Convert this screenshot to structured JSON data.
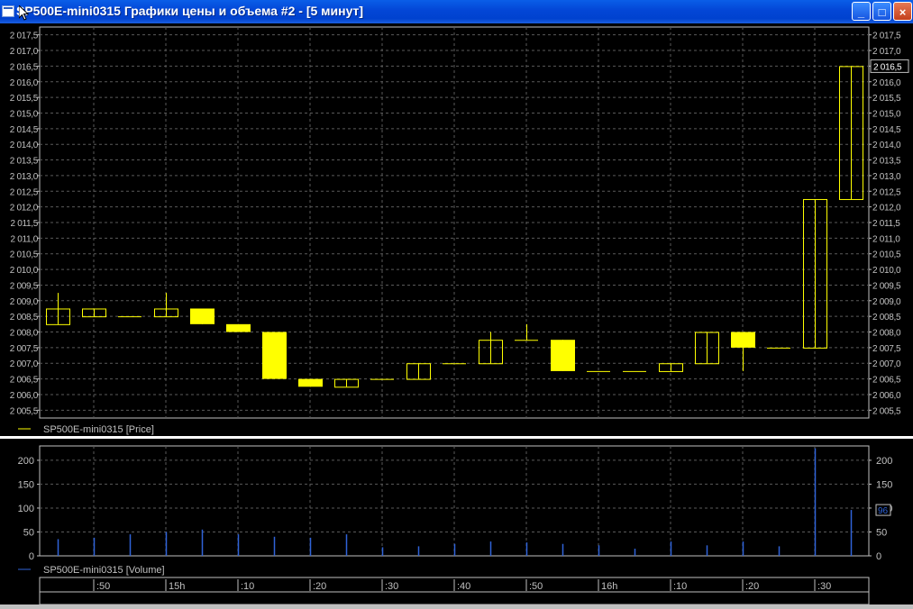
{
  "window": {
    "title": "SP500E-mini0315 Графики цены и объема #2 - [5 минут]",
    "buttons": {
      "minimize": "_",
      "maximize": "□",
      "close": "×"
    }
  },
  "colors": {
    "background": "#000000",
    "grid": "#5a5a5a",
    "axis": "#c0c0c0",
    "candle": "#ffff00",
    "volume": "#2f63d8",
    "titlebar": "#0346d6"
  },
  "chart_data": [
    {
      "type": "candlestick",
      "legend": "SP500E-mini0315 [Price]",
      "ylim": [
        2005.25,
        2017.75
      ],
      "yticks": [
        "2 005,5",
        "2 006,0",
        "2 006,5",
        "2 007,0",
        "2 007,5",
        "2 008,0",
        "2 008,5",
        "2 009,0",
        "2 009,5",
        "2 010,0",
        "2 010,5",
        "2 011,0",
        "2 011,5",
        "2 012,0",
        "2 012,5",
        "2 013,0",
        "2 013,5",
        "2 014,0",
        "2 014,5",
        "2 015,0",
        "2 015,5",
        "2 016,0",
        "2 016,5",
        "2 017,0",
        "2 017,5"
      ],
      "last_value_label": "2 016,5",
      "last_value": 2016.5,
      "candles": [
        {
          "o": 2008.25,
          "h": 2009.25,
          "l": 2008.25,
          "c": 2008.75
        },
        {
          "o": 2008.5,
          "h": 2008.75,
          "l": 2008.5,
          "c": 2008.75
        },
        {
          "o": 2008.5,
          "h": 2008.5,
          "l": 2008.5,
          "c": 2008.5
        },
        {
          "o": 2008.5,
          "h": 2009.25,
          "l": 2008.5,
          "c": 2008.75
        },
        {
          "o": 2008.75,
          "h": 2008.75,
          "l": 2008.25,
          "c": 2008.25
        },
        {
          "o": 2008.25,
          "h": 2008.25,
          "l": 2008.0,
          "c": 2008.0
        },
        {
          "o": 2008.0,
          "h": 2008.0,
          "l": 2006.5,
          "c": 2006.5
        },
        {
          "o": 2006.5,
          "h": 2006.5,
          "l": 2006.25,
          "c": 2006.25
        },
        {
          "o": 2006.25,
          "h": 2006.5,
          "l": 2006.25,
          "c": 2006.5
        },
        {
          "o": 2006.5,
          "h": 2006.5,
          "l": 2006.5,
          "c": 2006.5
        },
        {
          "o": 2006.5,
          "h": 2007.0,
          "l": 2006.5,
          "c": 2007.0
        },
        {
          "o": 2007.0,
          "h": 2007.0,
          "l": 2007.0,
          "c": 2007.0
        },
        {
          "o": 2007.0,
          "h": 2008.0,
          "l": 2007.0,
          "c": 2007.75
        },
        {
          "o": 2007.75,
          "h": 2008.25,
          "l": 2007.75,
          "c": 2007.75
        },
        {
          "o": 2007.75,
          "h": 2007.75,
          "l": 2006.75,
          "c": 2006.75
        },
        {
          "o": 2006.75,
          "h": 2006.75,
          "l": 2006.75,
          "c": 2006.75
        },
        {
          "o": 2006.75,
          "h": 2006.75,
          "l": 2006.75,
          "c": 2006.75
        },
        {
          "o": 2006.75,
          "h": 2007.0,
          "l": 2006.75,
          "c": 2007.0
        },
        {
          "o": 2007.0,
          "h": 2008.0,
          "l": 2007.0,
          "c": 2008.0
        },
        {
          "o": 2008.0,
          "h": 2008.0,
          "l": 2006.75,
          "c": 2007.5
        },
        {
          "o": 2007.5,
          "h": 2007.5,
          "l": 2007.5,
          "c": 2007.5
        },
        {
          "o": 2007.5,
          "h": 2012.25,
          "l": 2007.5,
          "c": 2012.25
        },
        {
          "o": 2012.25,
          "h": 2016.5,
          "l": 2012.25,
          "c": 2016.5
        }
      ]
    },
    {
      "type": "bar",
      "legend": "SP500E-mini0315 [Volume]",
      "ylim": [
        0,
        230
      ],
      "yticks": [
        "0",
        "50",
        "100",
        "150",
        "200"
      ],
      "last_value_label": "96",
      "values": [
        35,
        38,
        45,
        50,
        55,
        45,
        40,
        38,
        45,
        18,
        20,
        25,
        30,
        28,
        25,
        22,
        15,
        30,
        22,
        30,
        20,
        225,
        96
      ]
    }
  ],
  "time_axis": {
    "labels": [
      ":50",
      "15h",
      ":10",
      ":20",
      ":30",
      ":40",
      ":50",
      "16h",
      ":10",
      ":20",
      ":30"
    ]
  }
}
